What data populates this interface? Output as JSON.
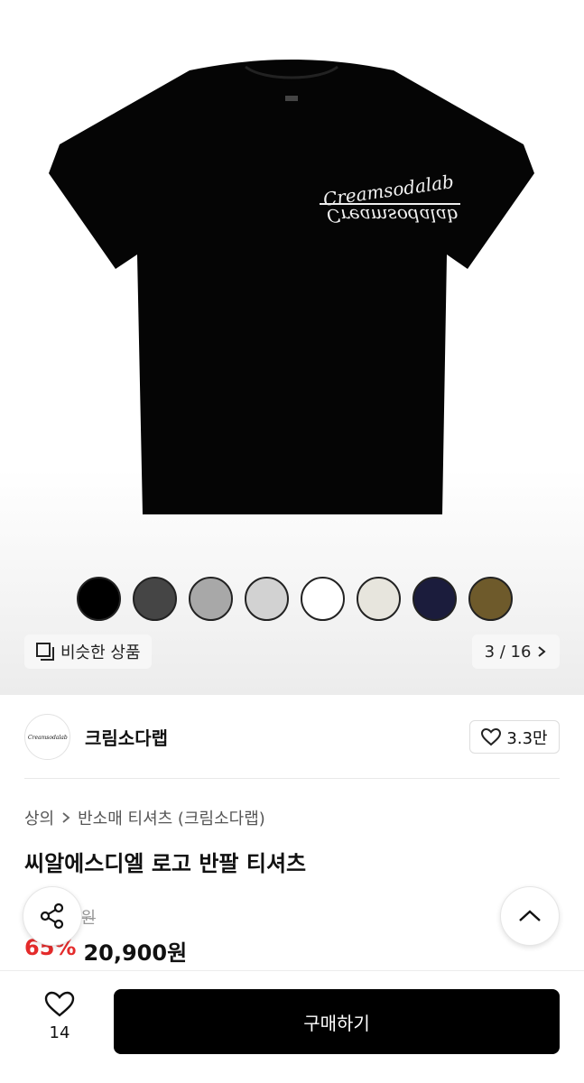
{
  "gallery": {
    "shirt_logo_text": "Creamsodalab",
    "swatch_colors": [
      "#000000",
      "#454545",
      "#a8a8a8",
      "#d2d2d2",
      "#ffffff",
      "#e7e5dd",
      "#1b1c3c",
      "#6e5a2b"
    ],
    "similar_label": "비슷한 상품",
    "similar_icon": "similar-items-icon",
    "counter": "3 / 16",
    "counter_icon": "chevron-right-icon"
  },
  "brand": {
    "logo_text": "Creamsodalab",
    "name": "크림소다랩",
    "likes": "3.3만",
    "like_icon": "heart-icon"
  },
  "breadcrumb": {
    "category": "상의",
    "subcategory": "반소매 티셔츠 (크림소다랩)"
  },
  "product": {
    "title": "씨알에스디엘 로고 반팔 티셔츠",
    "original_price_visible": "0원",
    "discount": "65%",
    "price": "20,900원"
  },
  "floating": {
    "share_icon": "share-icon",
    "top_icon": "chevron-up-icon"
  },
  "bottom": {
    "wish_count": "14",
    "wish_icon": "heart-icon",
    "buy_label": "구매하기"
  }
}
